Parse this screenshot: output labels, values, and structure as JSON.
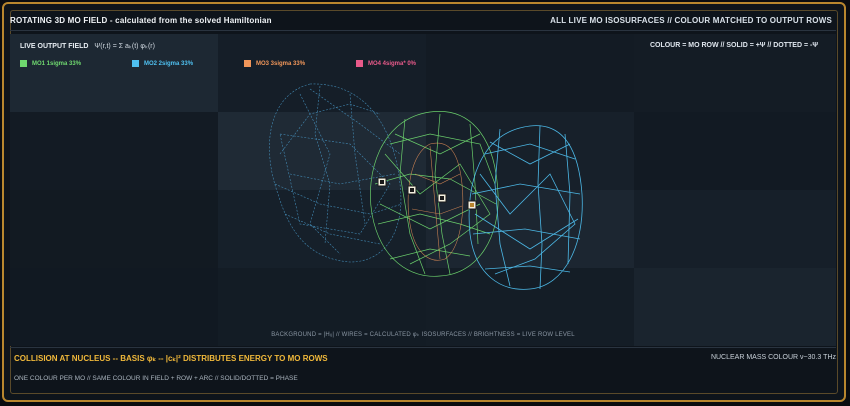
{
  "header": {
    "title": "ROTATING 3D MO FIELD - calculated from the solved Hamiltonian",
    "right": "ALL LIVE MO ISOSURFACES // COLOUR MATCHED TO OUTPUT ROWS"
  },
  "viewport": {
    "live_label": "LIVE OUTPUT FIELD",
    "live_formula": "Ψ(r,t) = Σ aₖ(t) φₖ(r)",
    "right_label": "COLOUR = MO ROW  //  SOLID = +Ψ  //  DOTTED = -Ψ",
    "caption": "BACKGROUND = |Hᵢⱼ|  //  WIRES = CALCULATED φₖ ISOSURFACES  //  BRIGHTNESS = LIVE ROW LEVEL",
    "legend": [
      {
        "label": "MO1 1sigma 33%",
        "color": "#6fd86f"
      },
      {
        "label": "MO2 2sigma 33%",
        "color": "#4fc0f0"
      },
      {
        "label": "MO3 3sigma 33%",
        "color": "#f0965a"
      },
      {
        "label": "MO4 4sigma* 0%",
        "color": "#e85a8a"
      }
    ]
  },
  "footer": {
    "title": "COLLISION AT NUCLEUS -- BASIS φₖ -- |cₖ|² DISTRIBUTES ENERGY TO MO ROWS",
    "right": "NUCLEAR MASS COLOUR  ν~30.3 THz",
    "sub": "ONE COLOUR PER MO  //  SAME COLOUR IN FIELD + ROW + ARC  //  SOLID/DOTTED = PHASE"
  },
  "colors": {
    "frame": "#b8862e",
    "accent": "#f0b83a",
    "mo1": "#6fd86f",
    "mo2": "#4fc0f0",
    "mo3": "#f0965a",
    "mo4": "#e85a8a"
  }
}
